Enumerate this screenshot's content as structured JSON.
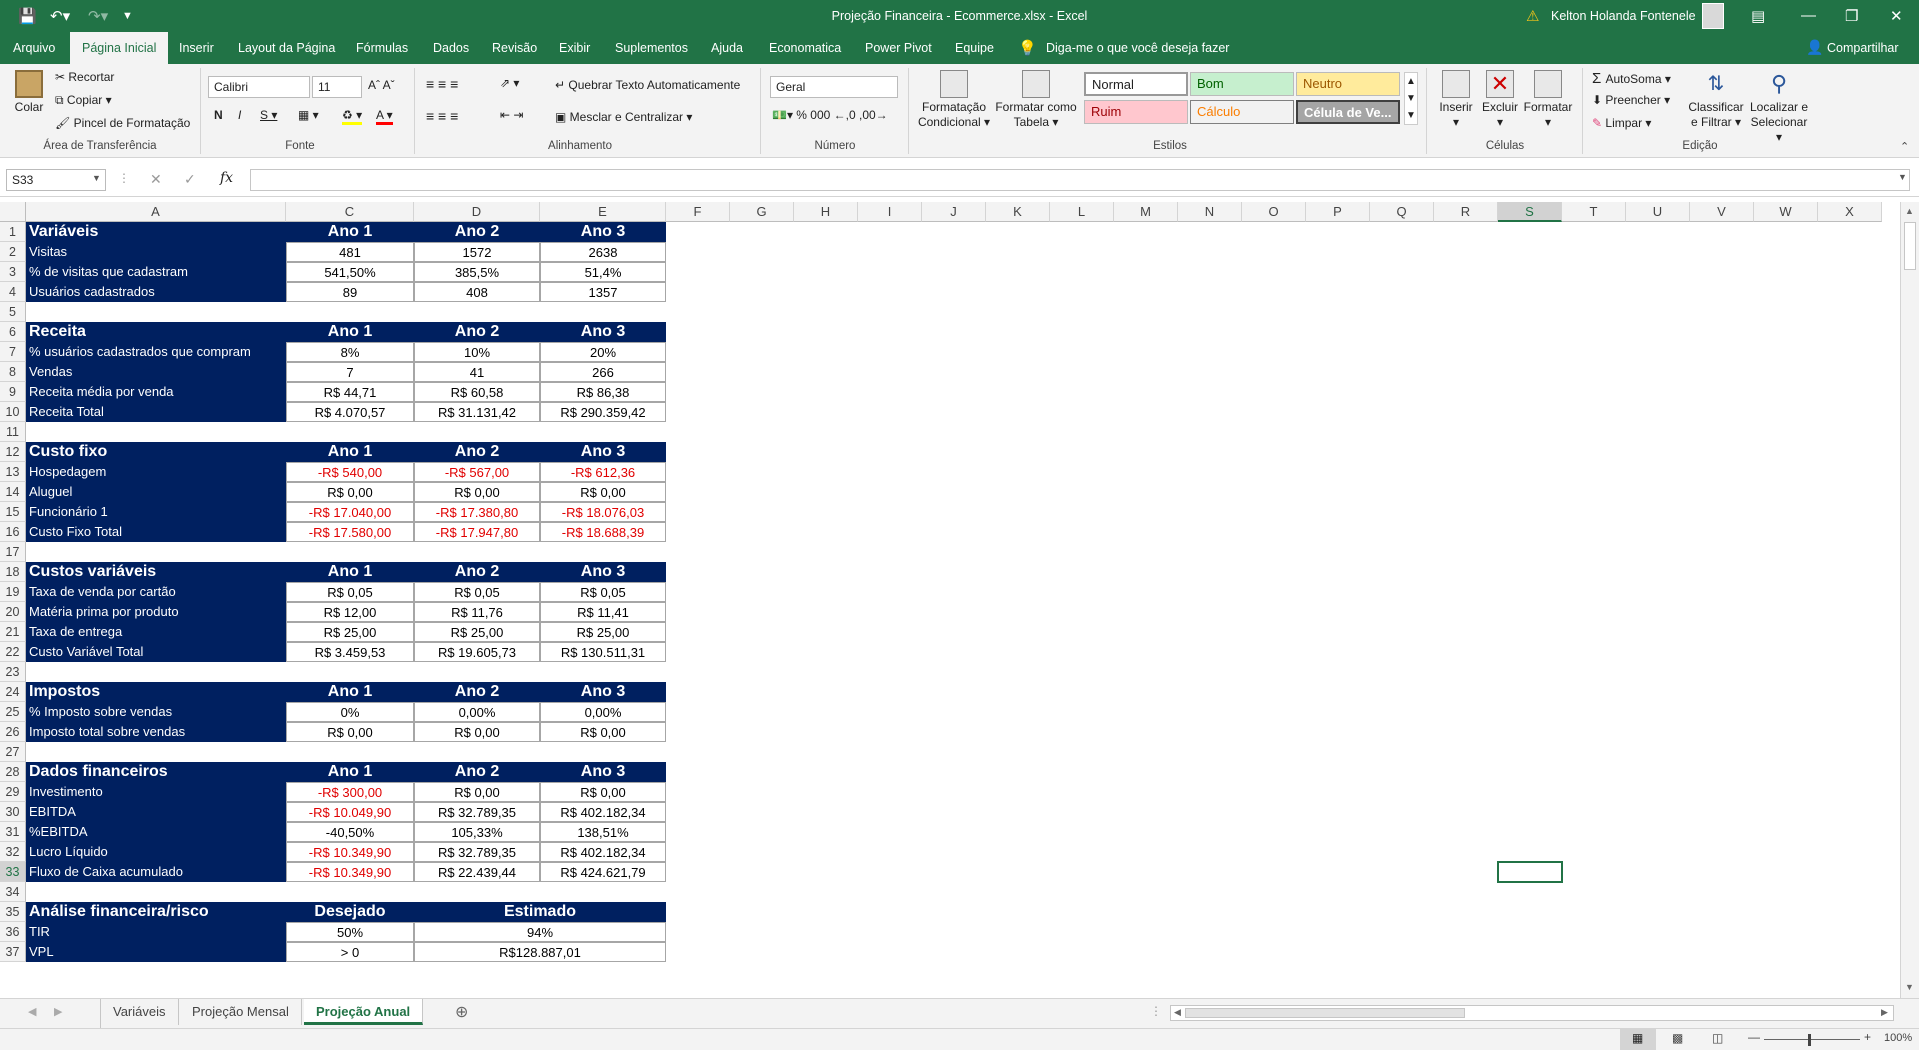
{
  "titlebar": {
    "title": "Projeção Financeira - Ecommerce.xlsx  -  Excel",
    "user": "Kelton Holanda Fontenele"
  },
  "menu": {
    "items": [
      "Arquivo",
      "Página Inicial",
      "Inserir",
      "Layout da Página",
      "Fórmulas",
      "Dados",
      "Revisão",
      "Exibir",
      "Suplementos",
      "Ajuda",
      "Economatica",
      "Power Pivot",
      "Equipe"
    ],
    "active": "Página Inicial",
    "tellme": "Diga-me o que você deseja fazer",
    "share": "Compartilhar"
  },
  "ribbon": {
    "clipboard": {
      "paste": "Colar",
      "cut": "Recortar",
      "copy": "Copiar",
      "painter": "Pincel de Formatação",
      "label": "Área de Transferência"
    },
    "font": {
      "name": "Calibri",
      "size": "11",
      "label": "Fonte"
    },
    "alignment": {
      "wrap": "Quebrar Texto Automaticamente",
      "merge": "Mesclar e Centralizar",
      "label": "Alinhamento"
    },
    "number": {
      "format": "Geral",
      "label": "Número"
    },
    "styles": {
      "cond_line1": "Formatação",
      "cond_line2": "Condicional",
      "table_line1": "Formatar como",
      "table_line2": "Tabela",
      "normal": "Normal",
      "bom": "Bom",
      "neutro": "Neutro",
      "ruim": "Ruim",
      "calculo": "Cálculo",
      "celula": "Célula de Ve...",
      "label": "Estilos"
    },
    "cells": {
      "insert": "Inserir",
      "delete": "Excluir",
      "format": "Formatar",
      "label": "Células"
    },
    "editing": {
      "autosum": "AutoSoma",
      "fill": "Preencher",
      "clear": "Limpar",
      "sort_line1": "Classificar",
      "sort_line2": "e Filtrar",
      "find_line1": "Localizar e",
      "find_line2": "Selecionar",
      "label": "Edição"
    }
  },
  "formula_bar": {
    "name_box": "S33",
    "formula": ""
  },
  "columns": [
    "A",
    "C",
    "D",
    "E",
    "F",
    "G",
    "H",
    "I",
    "J",
    "K",
    "L",
    "M",
    "N",
    "O",
    "P",
    "Q",
    "R",
    "S",
    "T",
    "U",
    "V",
    "W",
    "X"
  ],
  "selected_column": "S",
  "selected_row": "33",
  "sheet_rows": [
    {
      "n": "1",
      "type": "header",
      "label": "Variáveis",
      "c": "Ano 1",
      "d": "Ano 2",
      "e": "Ano 3"
    },
    {
      "n": "2",
      "type": "data",
      "label": "Visitas",
      "c": "481",
      "d": "1572",
      "e": "2638"
    },
    {
      "n": "3",
      "type": "data",
      "label": "% de visitas que cadastram",
      "c": "541,50%",
      "d": "385,5%",
      "e": "51,4%"
    },
    {
      "n": "4",
      "type": "data",
      "label": "Usuários cadastrados",
      "c": "89",
      "d": "408",
      "e": "1357"
    },
    {
      "n": "5",
      "type": "empty"
    },
    {
      "n": "6",
      "type": "header",
      "label": "Receita",
      "c": "Ano 1",
      "d": "Ano 2",
      "e": "Ano 3"
    },
    {
      "n": "7",
      "type": "data",
      "label": "% usuários cadastrados que compram",
      "c": "8%",
      "d": "10%",
      "e": "20%"
    },
    {
      "n": "8",
      "type": "data",
      "label": "Vendas",
      "c": "7",
      "d": "41",
      "e": "266"
    },
    {
      "n": "9",
      "type": "data",
      "label": "Receita média por venda",
      "c": "R$ 44,71",
      "d": "R$ 60,58",
      "e": "R$ 86,38"
    },
    {
      "n": "10",
      "type": "data",
      "label": "Receita Total",
      "c": "R$ 4.070,57",
      "d": "R$ 31.131,42",
      "e": "R$ 290.359,42"
    },
    {
      "n": "11",
      "type": "empty"
    },
    {
      "n": "12",
      "type": "header",
      "label": "Custo fixo",
      "c": "Ano 1",
      "d": "Ano 2",
      "e": "Ano 3"
    },
    {
      "n": "13",
      "type": "data",
      "label": "Hospedagem",
      "c": "-R$ 540,00",
      "d": "-R$ 567,00",
      "e": "-R$ 612,36",
      "neg": [
        "c",
        "d",
        "e"
      ]
    },
    {
      "n": "14",
      "type": "data",
      "label": "Aluguel",
      "c": "R$ 0,00",
      "d": "R$ 0,00",
      "e": "R$ 0,00"
    },
    {
      "n": "15",
      "type": "data",
      "label": "Funcionário 1",
      "c": "-R$ 17.040,00",
      "d": "-R$ 17.380,80",
      "e": "-R$ 18.076,03",
      "neg": [
        "c",
        "d",
        "e"
      ]
    },
    {
      "n": "16",
      "type": "data",
      "label": "Custo Fixo Total",
      "c": "-R$ 17.580,00",
      "d": "-R$ 17.947,80",
      "e": "-R$ 18.688,39",
      "neg": [
        "c",
        "d",
        "e"
      ]
    },
    {
      "n": "17",
      "type": "empty"
    },
    {
      "n": "18",
      "type": "header",
      "label": "Custos variáveis",
      "c": "Ano 1",
      "d": "Ano 2",
      "e": "Ano 3"
    },
    {
      "n": "19",
      "type": "data",
      "label": "Taxa de venda por cartão",
      "c": "R$ 0,05",
      "d": "R$ 0,05",
      "e": "R$ 0,05"
    },
    {
      "n": "20",
      "type": "data",
      "label": "Matéria prima por produto",
      "c": "R$ 12,00",
      "d": "R$ 11,76",
      "e": "R$ 11,41"
    },
    {
      "n": "21",
      "type": "data",
      "label": "Taxa de entrega",
      "c": "R$ 25,00",
      "d": "R$ 25,00",
      "e": "R$ 25,00"
    },
    {
      "n": "22",
      "type": "data",
      "label": "Custo Variável Total",
      "c": "R$ 3.459,53",
      "d": "R$ 19.605,73",
      "e": "R$ 130.511,31"
    },
    {
      "n": "23",
      "type": "empty"
    },
    {
      "n": "24",
      "type": "header",
      "label": "Impostos",
      "c": "Ano 1",
      "d": "Ano 2",
      "e": "Ano 3"
    },
    {
      "n": "25",
      "type": "data",
      "label": "% Imposto sobre vendas",
      "c": "0%",
      "d": "0,00%",
      "e": "0,00%"
    },
    {
      "n": "26",
      "type": "data",
      "label": "Imposto total sobre vendas",
      "c": "R$ 0,00",
      "d": "R$ 0,00",
      "e": "R$ 0,00"
    },
    {
      "n": "27",
      "type": "empty"
    },
    {
      "n": "28",
      "type": "header",
      "label": "Dados financeiros",
      "c": "Ano 1",
      "d": "Ano 2",
      "e": "Ano 3"
    },
    {
      "n": "29",
      "type": "data",
      "label": "Investimento",
      "c": "-R$ 300,00",
      "d": "R$ 0,00",
      "e": "R$ 0,00",
      "neg": [
        "c"
      ]
    },
    {
      "n": "30",
      "type": "data",
      "label": "EBITDA",
      "c": "-R$ 10.049,90",
      "d": "R$ 32.789,35",
      "e": "R$ 402.182,34",
      "neg": [
        "c"
      ]
    },
    {
      "n": "31",
      "type": "data",
      "label": "%EBITDA",
      "c": "-40,50%",
      "d": "105,33%",
      "e": "138,51%"
    },
    {
      "n": "32",
      "type": "data",
      "label": "Lucro Líquido",
      "c": "-R$ 10.349,90",
      "d": "R$ 32.789,35",
      "e": "R$ 402.182,34",
      "neg": [
        "c"
      ]
    },
    {
      "n": "33",
      "type": "data",
      "label": "Fluxo de Caixa acumulado",
      "c": "-R$ 10.349,90",
      "d": "R$ 22.439,44",
      "e": "R$ 424.621,79",
      "neg": [
        "c"
      ]
    },
    {
      "n": "34",
      "type": "empty"
    },
    {
      "n": "35",
      "type": "header2",
      "label": "Análise financeira/risco",
      "c": "Desejado",
      "de": "Estimado"
    },
    {
      "n": "36",
      "type": "data2",
      "label": "TIR",
      "c": "50%",
      "de": "94%"
    },
    {
      "n": "37",
      "type": "data2",
      "label": "VPL",
      "c": "> 0",
      "de": "R$128.887,01"
    }
  ],
  "sheets": [
    "Variáveis",
    "Projeção Mensal",
    "Projeção Anual"
  ],
  "active_sheet": "Projeção Anual",
  "status": {
    "zoom": "100%"
  }
}
